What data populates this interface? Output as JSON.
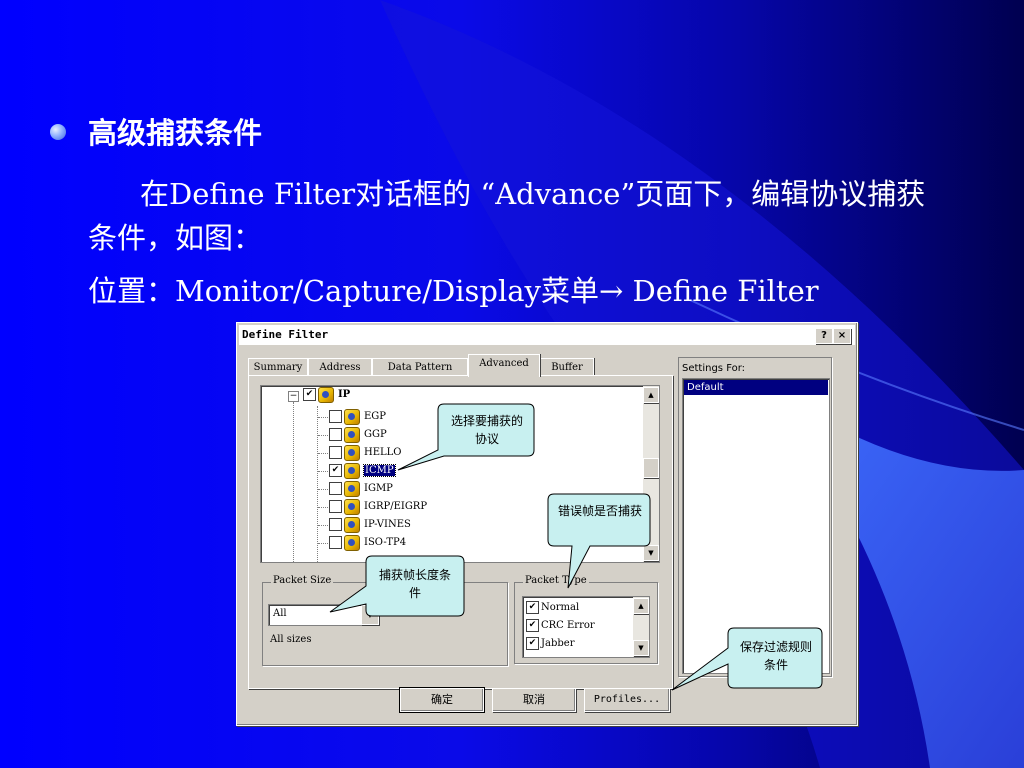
{
  "slide": {
    "heading": "高级捕获条件",
    "body_line1": "在Define Filter对话框的 “Advance”页面下，编辑协议捕获条件，如图：",
    "body_line2": "位置：Monitor/Capture/Display菜单→ Define Filter"
  },
  "dialog": {
    "title": "Define Filter",
    "help_button": "?",
    "close_button": "×",
    "tabs": [
      {
        "label": "Summary",
        "active": false
      },
      {
        "label": "Address",
        "active": false
      },
      {
        "label": "Data Pattern",
        "active": false
      },
      {
        "label": "Advanced",
        "active": true
      },
      {
        "label": "Buffer",
        "active": false
      }
    ],
    "tree": {
      "root": {
        "label": "IP",
        "checked": true,
        "expand": "−"
      },
      "items": [
        {
          "label": "EGP",
          "checked": false,
          "selected": false
        },
        {
          "label": "GGP",
          "checked": false,
          "selected": false
        },
        {
          "label": "HELLO",
          "checked": false,
          "selected": false
        },
        {
          "label": "ICMP",
          "checked": true,
          "selected": true
        },
        {
          "label": "IGMP",
          "checked": false,
          "selected": false
        },
        {
          "label": "IGRP/EIGRP",
          "checked": false,
          "selected": false
        },
        {
          "label": "IP-VINES",
          "checked": false,
          "selected": false
        },
        {
          "label": "ISO-TP4",
          "checked": false,
          "selected": false
        }
      ]
    },
    "packet_size": {
      "group_label": "Packet Size",
      "value": "All",
      "description": "All sizes"
    },
    "packet_type": {
      "group_label": "Packet Type",
      "items": [
        {
          "label": "Normal",
          "checked": true
        },
        {
          "label": "CRC Error",
          "checked": true
        },
        {
          "label": "Jabber",
          "checked": true
        }
      ]
    },
    "settings": {
      "label": "Settings For:",
      "selected": "Default"
    },
    "buttons": {
      "ok": "确定",
      "cancel": "取消",
      "profiles": "Profiles..."
    }
  },
  "callouts": {
    "protocol": "选择要捕获的协议",
    "error_frame": "错误帧是否捕获",
    "frame_length": "捕获帧长度条件",
    "save": "保存过滤规则条件"
  },
  "colors": {
    "background_start": "#0000ff",
    "background_end": "#000050",
    "callout_fill": "#c8f0f0",
    "selection": "#000080"
  }
}
